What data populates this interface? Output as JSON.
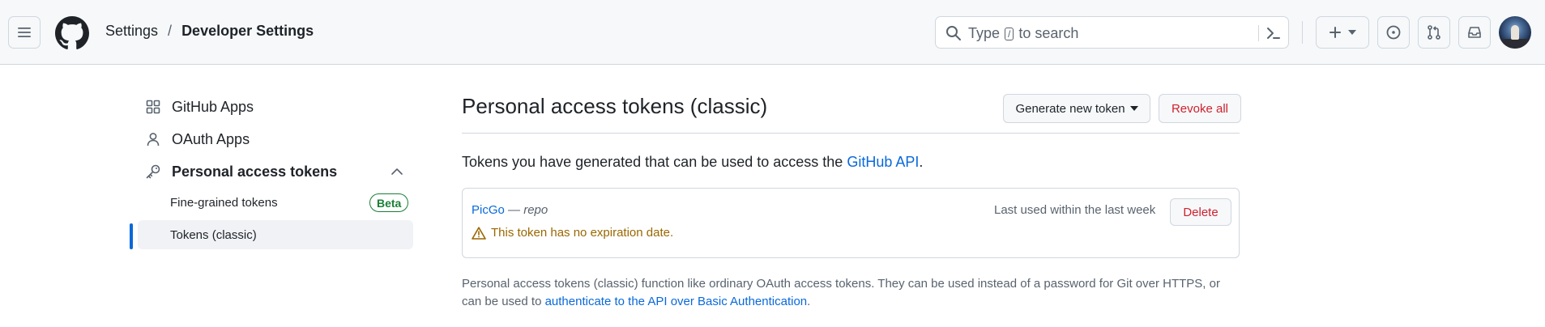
{
  "header": {
    "breadcrumb": {
      "root": "Settings",
      "separator": "/",
      "current": "Developer Settings"
    },
    "search": {
      "before": "Type",
      "key": "/",
      "after": "to search"
    }
  },
  "sidebar": {
    "items": [
      {
        "label": "GitHub Apps",
        "icon": "apps-grid-icon"
      },
      {
        "label": "OAuth Apps",
        "icon": "person-icon"
      },
      {
        "label": "Personal access tokens",
        "icon": "key-icon"
      }
    ],
    "sub_items": [
      {
        "label": "Fine-grained tokens",
        "badge": "Beta"
      },
      {
        "label": "Tokens (classic)"
      }
    ]
  },
  "main": {
    "title": "Personal access tokens (classic)",
    "generate_label": "Generate new token",
    "revoke_label": "Revoke all",
    "intro_text": "Tokens you have generated that can be used to access the ",
    "intro_link": "GitHub API",
    "intro_end": ".",
    "token": {
      "name": "PicGo",
      "dash": " — ",
      "scope": "repo",
      "warning": "This token has no expiration date.",
      "last_used": "Last used within the last week",
      "delete_label": "Delete"
    },
    "footnote_text": "Personal access tokens (classic) function like ordinary OAuth access tokens. They can be used instead of a password for Git over HTTPS, or can be used to ",
    "footnote_link": "authenticate to the API over Basic Authentication",
    "footnote_end": "."
  },
  "colors": {
    "accent": "#0969da",
    "danger": "#cf222e",
    "success": "#1a7f37",
    "warning": "#9a6700"
  }
}
